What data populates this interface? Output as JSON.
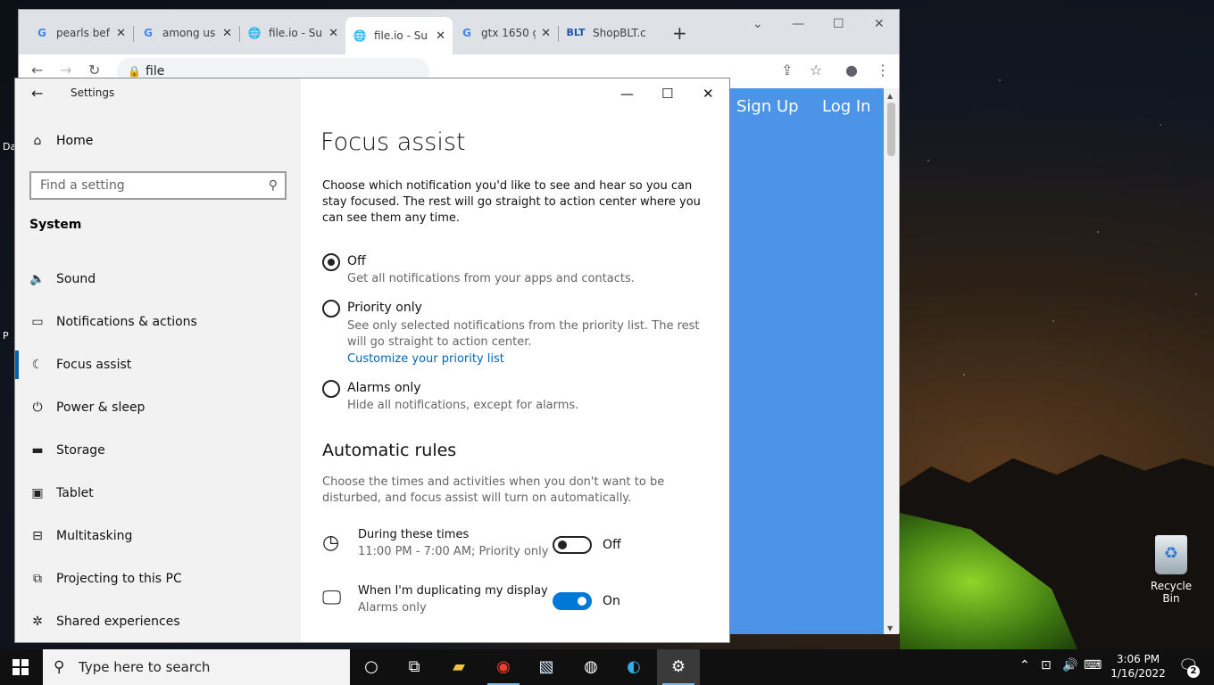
{
  "browser": {
    "tabs": [
      {
        "title": "pearls bef",
        "favicon": "G"
      },
      {
        "title": "among us",
        "favicon": "G"
      },
      {
        "title": "file.io - Su",
        "favicon": "globe"
      },
      {
        "title": "file.io - Su",
        "favicon": "globe"
      },
      {
        "title": "gtx 1650 g",
        "favicon": "G"
      },
      {
        "title": "ShopBLT.c",
        "favicon": "BLT"
      }
    ],
    "address": "file",
    "page_links": {
      "sign_up": "Sign Up",
      "log_in": "Log In"
    }
  },
  "settings": {
    "app_title": "Settings",
    "home": "Home",
    "search_placeholder": "Find a setting",
    "section": "System",
    "nav_items": [
      {
        "label": "Sound",
        "icon": "speaker-icon"
      },
      {
        "label": "Notifications & actions",
        "icon": "notification-icon"
      },
      {
        "label": "Focus assist",
        "icon": "moon-icon",
        "selected": true
      },
      {
        "label": "Power & sleep",
        "icon": "power-icon"
      },
      {
        "label": "Storage",
        "icon": "storage-icon"
      },
      {
        "label": "Tablet",
        "icon": "tablet-icon"
      },
      {
        "label": "Multitasking",
        "icon": "multitasking-icon"
      },
      {
        "label": "Projecting to this PC",
        "icon": "projecting-icon"
      },
      {
        "label": "Shared experiences",
        "icon": "shared-icon"
      }
    ],
    "page": {
      "title": "Focus assist",
      "description": "Choose which notification you'd like to see and hear so you can stay focused. The rest will go straight to action center where you can see them any time.",
      "options": [
        {
          "label": "Off",
          "sub": "Get all notifications from your apps and contacts.",
          "checked": true
        },
        {
          "label": "Priority only",
          "sub": "See only selected notifications from the priority list. The rest will go straight to action center.",
          "link": "Customize your priority list",
          "checked": false
        },
        {
          "label": "Alarms only",
          "sub": "Hide all notifications, except for alarms.",
          "checked": false
        }
      ],
      "auto_title": "Automatic rules",
      "auto_desc": "Choose the times and activities when you don't want to be disturbed, and focus assist will turn on automatically.",
      "rules": [
        {
          "title": "During these times",
          "sub": "11:00 PM - 7:00 AM; Priority only",
          "state": "Off",
          "on": false
        },
        {
          "title": "When I'm duplicating my display",
          "sub": "Alarms only",
          "state": "On",
          "on": true
        }
      ]
    }
  },
  "desktop": {
    "recycle_bin": "Recycle Bin",
    "left_labels": [
      "Da",
      "P"
    ]
  },
  "taskbar": {
    "search_placeholder": "Type here to search",
    "time": "3:06 PM",
    "date": "1/16/2022",
    "notification_count": "2"
  },
  "colors": {
    "accent": "#0078d7",
    "web_blue": "#4b94e8",
    "link": "#0067b8"
  }
}
